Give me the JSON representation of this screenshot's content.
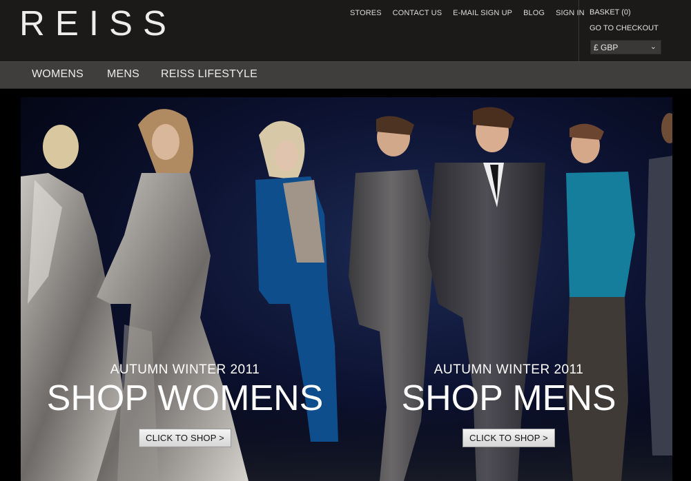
{
  "brand": {
    "logo_text": "REISS"
  },
  "utility_nav": [
    {
      "label": "STORES"
    },
    {
      "label": "CONTACT US"
    },
    {
      "label": "E-MAIL SIGN UP"
    },
    {
      "label": "BLOG"
    },
    {
      "label": "SIGN IN"
    }
  ],
  "account": {
    "basket_label": "BASKET (0)",
    "checkout_label": "GO TO CHECKOUT",
    "currency_selected": "£ GBP"
  },
  "main_nav": [
    {
      "label": "WOMENS"
    },
    {
      "label": "MENS"
    },
    {
      "label": "REISS LIFESTYLE"
    }
  ],
  "hero": {
    "womens": {
      "season": "AUTUMN WINTER 2011",
      "headline": "SHOP WOMENS",
      "cta_label": "CLICK TO SHOP >"
    },
    "mens": {
      "season": "AUTUMN WINTER 2011",
      "headline": "SHOP MENS",
      "cta_label": "CLICK TO SHOP >"
    }
  },
  "colors": {
    "header_bg": "#1c1a19",
    "nav_bg": "#403e3c",
    "hero_bg": "#0c1230"
  }
}
